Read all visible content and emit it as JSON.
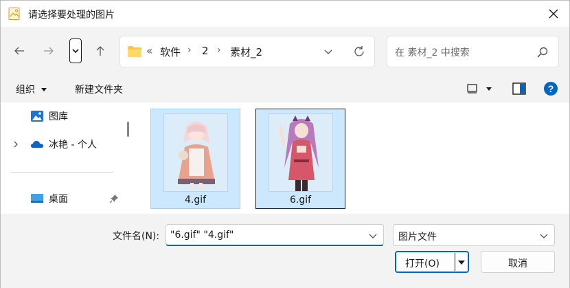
{
  "window": {
    "title": "请选择要处理的图片",
    "close_icon": "close-icon"
  },
  "nav": {
    "back_icon": "arrow-left-icon",
    "forward_icon": "arrow-right-icon",
    "recent_icon": "chevron-down-icon",
    "up_icon": "arrow-up-icon"
  },
  "address": {
    "overflow": "«",
    "crumbs": [
      "软件",
      "2",
      "素材_2"
    ],
    "separator": "›"
  },
  "search": {
    "placeholder": "在 素材_2 中搜索"
  },
  "commands": {
    "organize_label": "组织",
    "new_folder_label": "新建文件夹"
  },
  "sidebar": {
    "items": [
      {
        "label": "图库",
        "icon": "gallery-icon",
        "expandable": false,
        "pinned": false
      },
      {
        "label": "冰艳 - 个人",
        "icon": "onedrive-cloud-icon",
        "expandable": true,
        "pinned": false
      },
      {
        "label": "桌面",
        "icon": "desktop-icon",
        "expandable": false,
        "pinned": true
      }
    ]
  },
  "files": [
    {
      "name": "4.gif",
      "selected": true,
      "focused": false
    },
    {
      "name": "6.gif",
      "selected": true,
      "focused": true
    }
  ],
  "footer": {
    "filename_label": "文件名(N):",
    "filename_value": "\"6.gif\" \"4.gif\"",
    "filetype_value": "图片文件",
    "open_label": "打开(O)",
    "cancel_label": "取消"
  },
  "colors": {
    "selection_fill": "#cce8ff",
    "selection_border": "#99d1ff",
    "accent": "#0067c0",
    "chrome_bg": "#f3f3f3",
    "folder_yellow": "#ffc83d"
  }
}
